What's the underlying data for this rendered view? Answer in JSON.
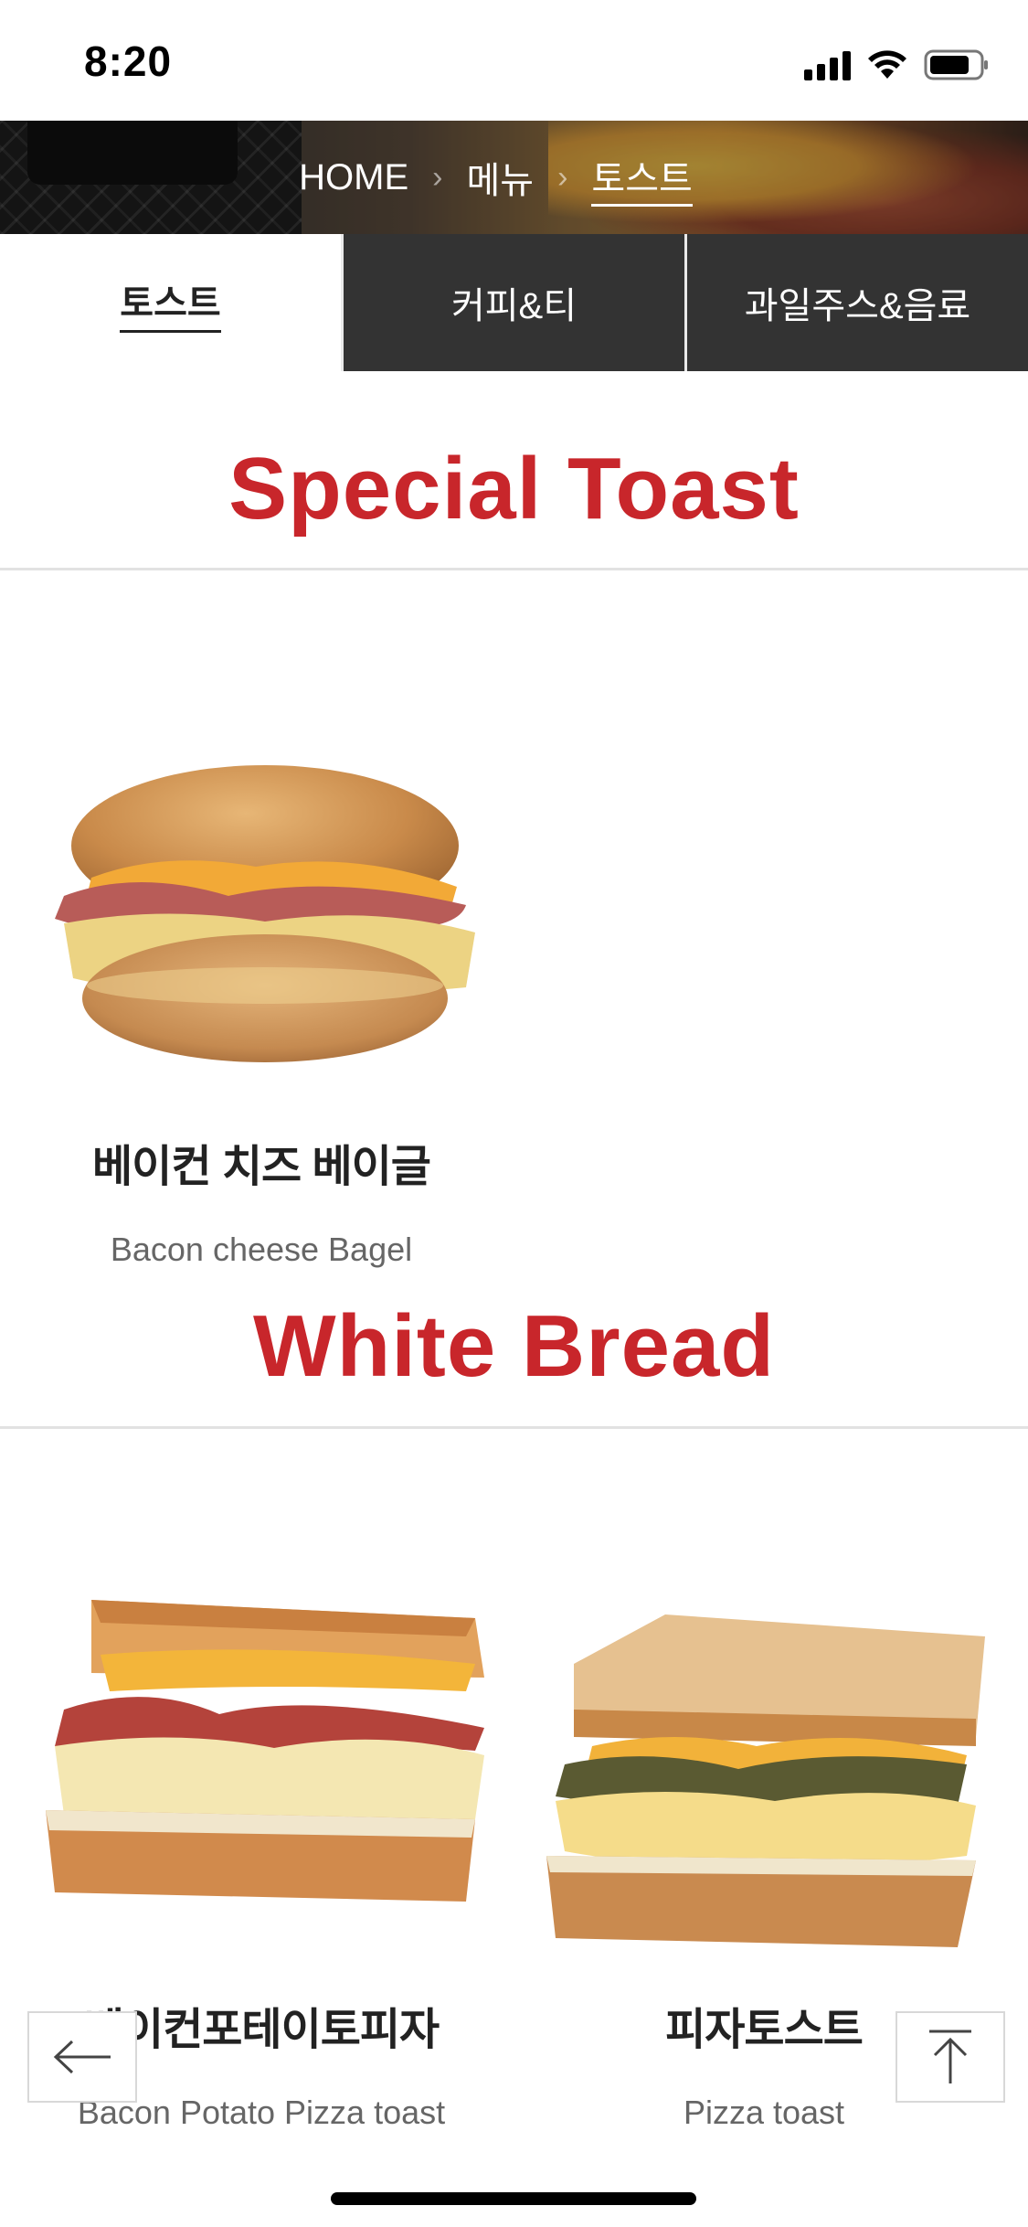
{
  "status_bar": {
    "time": "8:20"
  },
  "breadcrumb": {
    "items": [
      "HOME",
      "메뉴",
      "토스트"
    ],
    "separator": "›"
  },
  "tabs": [
    {
      "label": "토스트",
      "active": true
    },
    {
      "label": "커피&티",
      "active": false
    },
    {
      "label": "과일주스&음료",
      "active": false
    }
  ],
  "sections": [
    {
      "title": "Special Toast",
      "products": [
        {
          "name_ko": "베이컨 치즈 베이글",
          "name_en": "Bacon cheese Bagel",
          "image": "bagel-sandwich"
        }
      ]
    },
    {
      "title": "White Bread",
      "products": [
        {
          "name_ko": "베이컨포테이토피자",
          "name_en": "Bacon Potato Pizza toast",
          "image": "toast-sandwich"
        },
        {
          "name_ko": "피자토스트",
          "name_en": "Pizza toast",
          "image": "toast-sandwich"
        }
      ]
    }
  ],
  "floating": {
    "back_icon": "arrow-left-icon",
    "top_icon": "arrow-up-to-top-icon"
  },
  "colors": {
    "accent": "#c8262b",
    "tab_bg": "#333333"
  }
}
